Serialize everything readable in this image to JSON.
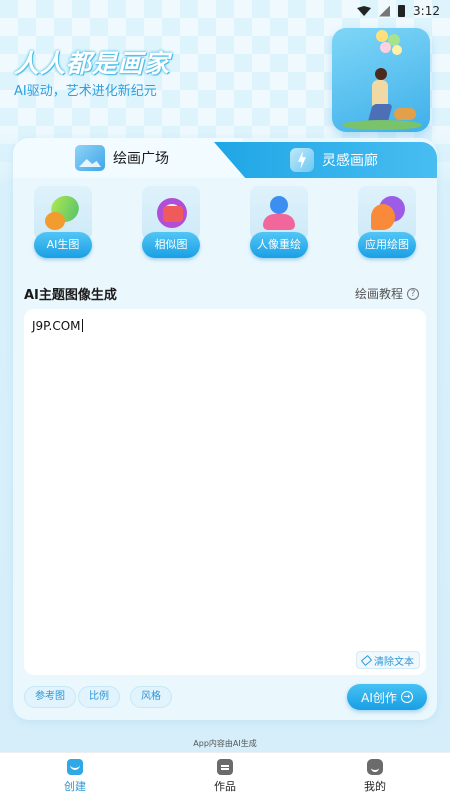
{
  "status_bar": {
    "time": "3:12"
  },
  "hero": {
    "title": "人人都是画家",
    "subtitle": "AI驱动，艺术进化新纪元"
  },
  "tabs": [
    {
      "label": "绘画广场",
      "active": true
    },
    {
      "label": "灵感画廊",
      "active": false
    }
  ],
  "features": [
    {
      "label": "AI生图",
      "icon": "ai-generate-icon"
    },
    {
      "label": "相似图",
      "icon": "similar-image-icon"
    },
    {
      "label": "人像重绘",
      "icon": "portrait-redraw-icon"
    },
    {
      "label": "应用绘图",
      "icon": "app-draw-icon"
    }
  ],
  "section": {
    "title": "AI主题图像生成",
    "tutorial_label": "绘画教程",
    "help_glyph": "?"
  },
  "prompt": {
    "value": "J9P.COM",
    "clear_label": "清除文本"
  },
  "options": {
    "reference_label": "参考图",
    "ratio_label": "比例",
    "style_label": "风格"
  },
  "create_button": {
    "label": "AI创作",
    "arrow_glyph": "→"
  },
  "footer_note": "App内容由AI生成",
  "bottom_nav": [
    {
      "label": "创建",
      "icon": "create-icon",
      "active": true
    },
    {
      "label": "作品",
      "icon": "works-icon",
      "active": false
    },
    {
      "label": "我的",
      "icon": "profile-icon",
      "active": false
    }
  ],
  "colors": {
    "accent": "#1fa6e6",
    "background": "#dff3fc",
    "title_outline": "#55c3ea"
  }
}
